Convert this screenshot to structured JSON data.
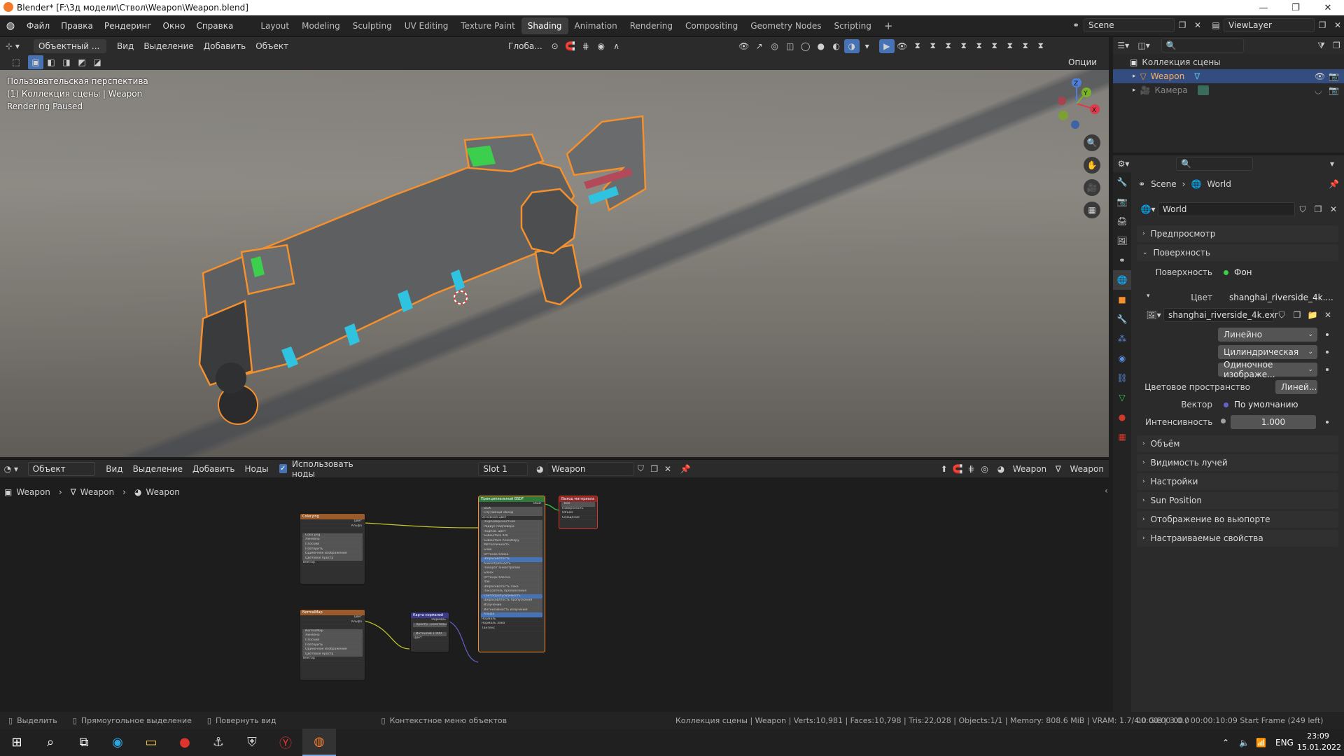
{
  "window": {
    "title": "Blender* [F:\\3д модели\\Ствол\\Weapon\\Weapon.blend]"
  },
  "menu": [
    "Файл",
    "Правка",
    "Рендеринг",
    "Окно",
    "Справка"
  ],
  "workspaces": [
    "Layout",
    "Modeling",
    "Sculpting",
    "UV Editing",
    "Texture Paint",
    "Shading",
    "Animation",
    "Rendering",
    "Compositing",
    "Geometry Nodes",
    "Scripting"
  ],
  "active_workspace": "Shading",
  "scene": "Scene",
  "view_layer": "ViewLayer",
  "viewport": {
    "mode": "Объектный ...",
    "menus": [
      "Вид",
      "Выделение",
      "Добавить",
      "Объект"
    ],
    "orientation": "Глоба...",
    "options": "Опции",
    "overlay_lines": [
      "Пользовательская перспектива",
      "(1) Коллекция сцены | Weapon",
      "Rendering Paused"
    ]
  },
  "node_editor": {
    "mode": "Объект",
    "menus": [
      "Вид",
      "Выделение",
      "Добавить",
      "Ноды"
    ],
    "use_nodes_label": "Использовать ноды",
    "slot": "Slot 1",
    "material": "Weapon",
    "object_label": "Weapon",
    "mesh_label": "Weapon",
    "breadcrumb": [
      "Weapon",
      "Weapon",
      "Weapon"
    ],
    "nodes": {
      "color_tex": {
        "title": "Color.png",
        "rows": [
          "Цвет",
          "Альфа",
          "",
          "Color.png",
          "Линейно",
          "Плоский",
          "Повторить",
          "Одиночное изображение",
          "Цветовое простр",
          "Вектор"
        ]
      },
      "normal_tex": {
        "title": "NormalMap",
        "rows": [
          "Цвет",
          "Альфа",
          "",
          "NormalMap",
          "Линейно",
          "Плоский",
          "Повторить",
          "Одиночное изображение",
          "Цветовое простр",
          "Вектор"
        ]
      },
      "normal_map": {
        "title": "Карта нормалей",
        "rows": [
          "Нормаль",
          "Простр...касательн",
          "",
          "Интенсив 1.000",
          "Цвет"
        ]
      },
      "bsdf": {
        "title": "Принципиальный BSDF",
        "rows": [
          "BSDF",
          "GGX",
          "Случайный обход",
          "Основной цвет",
          "Подповерхностное",
          "Радиус подповерх.",
          "Подпов. цвет",
          "Subsurface IOR",
          "Subsurface Anisotropy",
          "Металличность",
          "Блик",
          "Оттенок блика",
          "Шероховатость",
          "Анизотропность",
          "Поворот анизотропии",
          "Блеск",
          "Оттенок блеска",
          "Лак",
          "Шероховатость лака",
          "Показатель преломления",
          "Светопропускаемость",
          "Шероховатость пропускания",
          "Излучение",
          "Интенсивность излучения",
          "Альфа",
          "Нормаль",
          "Нормаль лака",
          "Тангенс"
        ]
      },
      "output": {
        "title": "Вывод материала",
        "rows": [
          "Все",
          "Поверхность",
          "Объём",
          "Смещение"
        ]
      }
    }
  },
  "outliner": {
    "collection": "Коллекция сцены",
    "items": [
      {
        "name": "Weapon",
        "selected": true
      },
      {
        "name": "Камера",
        "selected": false
      }
    ]
  },
  "properties": {
    "breadcrumb": [
      "Scene",
      "World"
    ],
    "world_name": "World",
    "panels_top": [
      "Предпросмотр",
      "Поверхность"
    ],
    "surface_label": "Поверхность",
    "surface_value": "Фон",
    "color_label": "Цвет",
    "color_value": "shanghai_riverside_4k....",
    "image_name": "shanghai_riverside_4k.exr",
    "interp": "Линейно",
    "projection": "Цилиндрическая",
    "source": "Одиночное изображе...",
    "colorspace_label": "Цветовое пространство",
    "colorspace_value": "Линей...",
    "vector_label": "Вектор",
    "vector_value": "По умолчанию",
    "strength_label": "Интенсивность",
    "strength_value": "1.000",
    "panels_bottom": [
      "Объём",
      "Видимость лучей",
      "Настройки",
      "Sun Position",
      "Отображение во вьюпорте",
      "Настраиваемые свойства"
    ]
  },
  "status": {
    "select": "Выделить",
    "box_select": "Прямоугольное выделение",
    "rotate": "Повернуть вид",
    "context": "Контекстное меню объектов",
    "stats": "Коллекция сцены | Weapon | Verts:10,981 | Faces:10,798 | Tris:22,028 | Objects:1/1 | Memory: 808.6 MiB | VRAM: 1.7/4.0 GiB | 3.0.0",
    "time": "00:00:00:00 / 00:00:10:09  Start Frame (249 left)"
  },
  "taskbar": {
    "lang": "ENG",
    "clock": "23:09",
    "date": "15.01.2022"
  },
  "colors": {
    "accent": "#4772b3",
    "selection_orange": "#f5902c",
    "cyan": "#2fc3e0",
    "green": "#3ccf4e"
  }
}
